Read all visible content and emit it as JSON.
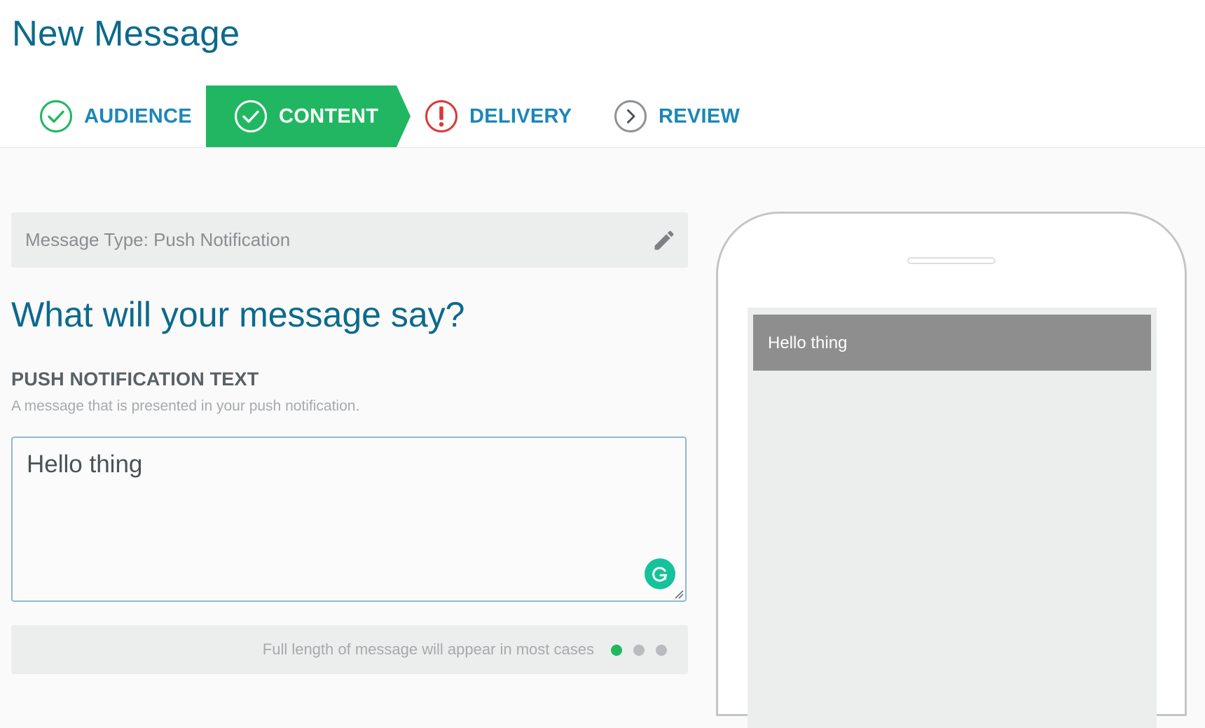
{
  "page": {
    "title": "New Message"
  },
  "steps": [
    {
      "label": "AUDIENCE",
      "status": "complete"
    },
    {
      "label": "CONTENT",
      "status": "active"
    },
    {
      "label": "DELIVERY",
      "status": "error"
    },
    {
      "label": "REVIEW",
      "status": "pending"
    }
  ],
  "message_type": {
    "label": "Message Type: Push Notification",
    "edit_icon": "pencil-icon"
  },
  "content": {
    "heading": "What will your message say?",
    "field_label": "PUSH NOTIFICATION TEXT",
    "field_help": "A message that is presented in your push notification.",
    "text_value": "Hello thing",
    "length_note": "Full length of message will appear in most cases"
  },
  "preview": {
    "notification_text": "Hello thing"
  },
  "colors": {
    "brand_blue": "#0b6a8c",
    "link_blue": "#1b87b8",
    "success_green": "#21b762",
    "error_red": "#d9393a",
    "dot_inactive": "#b9bcbe"
  }
}
